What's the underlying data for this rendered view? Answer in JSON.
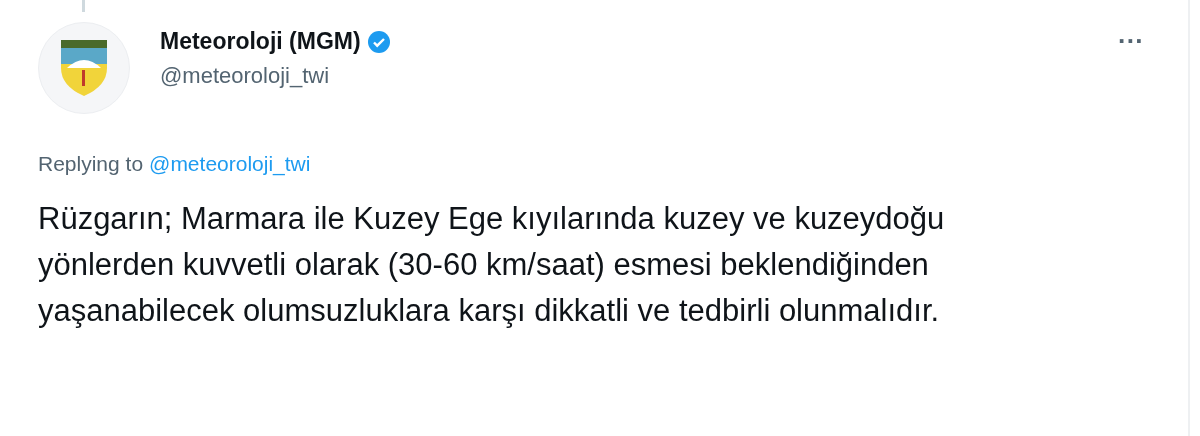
{
  "author": {
    "name": "Meteoroloji (MGM)",
    "verified": true,
    "handle": "@meteoroloji_twi"
  },
  "more_button": {
    "label": "···"
  },
  "reply_context": {
    "prefix": "Replying to",
    "mention": "@meteoroloji_twi"
  },
  "body": "Rüzgarın; Marmara ile Kuzey Ege kıyılarında kuzey ve kuzeydoğu yönlerden kuvvetli olarak (30-60 km/saat) esmesi beklendiğinden yaşanabilecek olumsuzluklara karşı dikkatli ve tedbirli olunmalıdır."
}
